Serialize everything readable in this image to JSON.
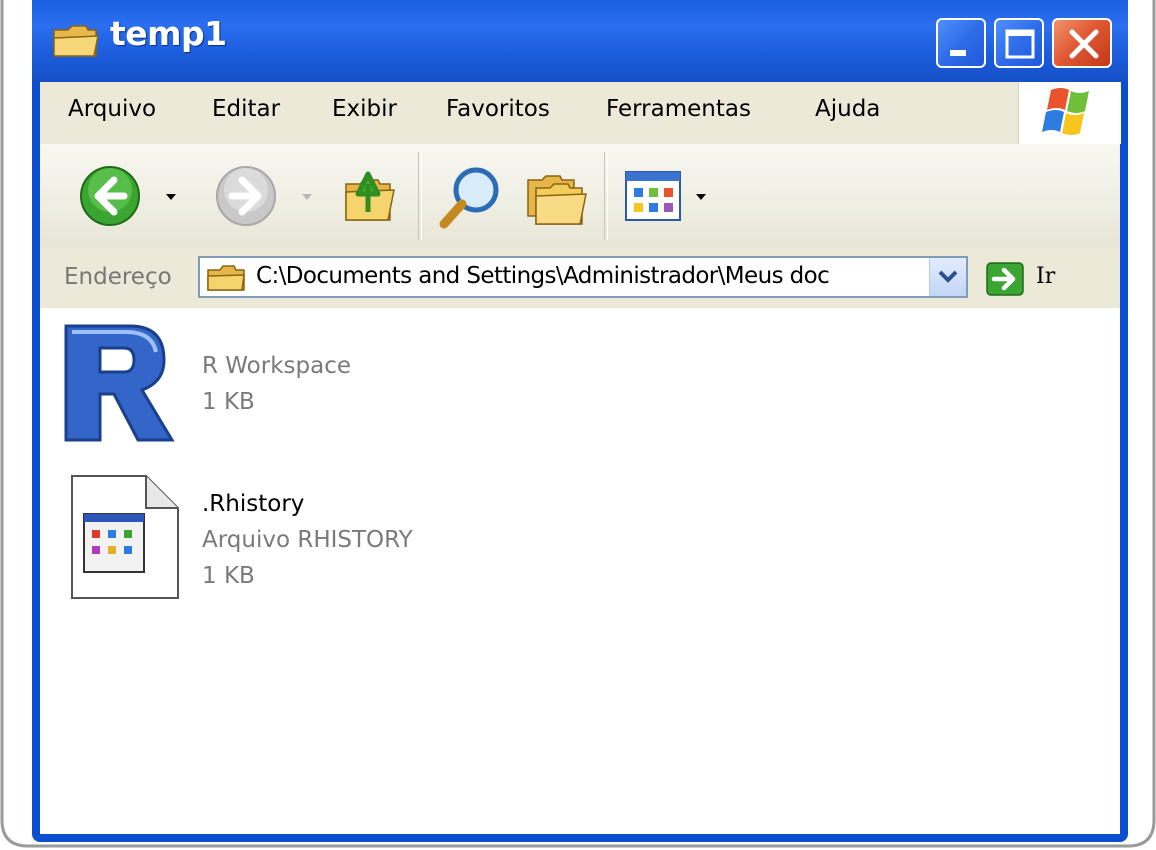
{
  "window": {
    "title": "temp1",
    "controls": {
      "minimize": "minimize",
      "maximize": "maximize",
      "close": "close"
    }
  },
  "menu": {
    "items": [
      "Arquivo",
      "Editar",
      "Exibir",
      "Favoritos",
      "Ferramentas",
      "Ajuda"
    ]
  },
  "toolbar": {
    "buttons": [
      "back-icon",
      "forward-icon",
      "up-folder-icon",
      "search-icon",
      "folders-icon",
      "views-icon"
    ]
  },
  "address": {
    "label": "Endereço",
    "value": "C:\\Documents and Settings\\Administrador\\Meus doc",
    "go_label": "Ir"
  },
  "files": [
    {
      "icon": "r-logo-icon",
      "name": "",
      "type": "R Workspace",
      "size": "1 KB"
    },
    {
      "icon": "text-file-icon",
      "name": ".Rhistory",
      "type": "Arquivo RHISTORY",
      "size": "1 KB"
    }
  ],
  "colors": {
    "titlebar": "#1b5bd9",
    "menubar": "#ece9d8",
    "close_button": "#e05a33"
  }
}
